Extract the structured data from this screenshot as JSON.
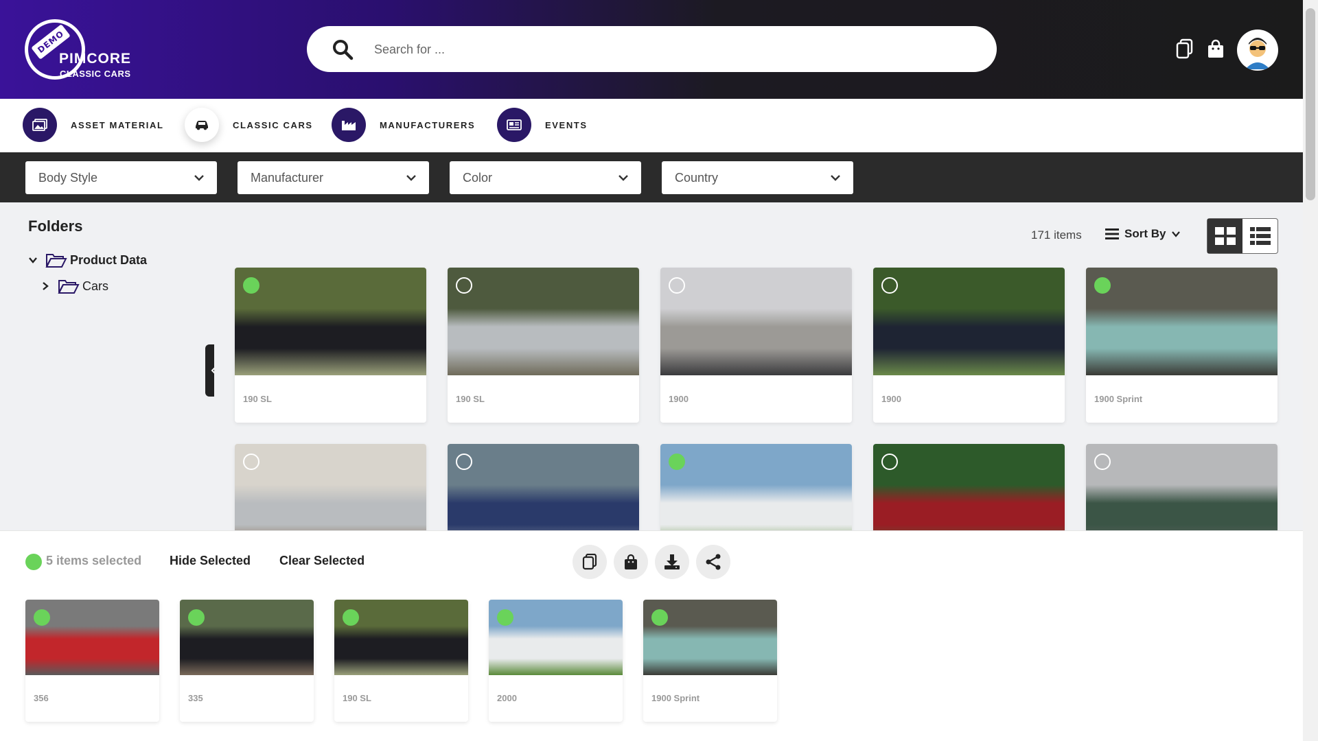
{
  "header": {
    "logo_demo": "DEMO",
    "logo_name": "PIMCORE",
    "logo_sub": "CLASSIC CARS",
    "search_placeholder": "Search for ...",
    "icons": [
      "search-icon",
      "copy-icon",
      "bag-icon",
      "avatar"
    ]
  },
  "nav": {
    "items": [
      {
        "label": "ASSET MATERIAL",
        "icon": "images-icon",
        "active": false
      },
      {
        "label": "CLASSIC CARS",
        "icon": "car-icon",
        "active": true
      },
      {
        "label": "MANUFACTURERS",
        "icon": "factory-icon",
        "active": false
      },
      {
        "label": "EVENTS",
        "icon": "newspaper-icon",
        "active": false
      }
    ]
  },
  "filters": [
    "Body Style",
    "Manufacturer",
    "Color",
    "Country"
  ],
  "sidebar": {
    "title": "Folders",
    "tree": [
      {
        "label": "Product Data",
        "expanded": true
      },
      {
        "label": "Cars",
        "expanded": false
      }
    ]
  },
  "toolbar": {
    "count": "171 items",
    "sort_label": "Sort By",
    "view_mode": "grid"
  },
  "cards": [
    {
      "title": "190 SL",
      "selected": true,
      "colors": [
        "#5a6b3a",
        "#1d1d22",
        "#9aa07a"
      ]
    },
    {
      "title": "190 SL",
      "selected": false,
      "colors": [
        "#4e5a3e",
        "#b8bcbf",
        "#6f6b5a"
      ]
    },
    {
      "title": "1900",
      "selected": false,
      "colors": [
        "#cfcfd2",
        "#9c9a96",
        "#3a3a3d"
      ]
    },
    {
      "title": "1900",
      "selected": false,
      "colors": [
        "#3b5a2a",
        "#1e2433",
        "#6b8a4a"
      ]
    },
    {
      "title": "1900 Sprint",
      "selected": true,
      "colors": [
        "#5a5a50",
        "#86b7b2",
        "#3a3a35"
      ]
    },
    {
      "title": "",
      "selected": false,
      "colors": [
        "#d8d4cc",
        "#b9bcbf",
        "#7a5a3a"
      ]
    },
    {
      "title": "",
      "selected": false,
      "colors": [
        "#6a7e8a",
        "#2a3a6a",
        "#9aa0a8"
      ]
    },
    {
      "title": "",
      "selected": true,
      "colors": [
        "#7ea7c9",
        "#e9ebec",
        "#5a8a3a"
      ]
    },
    {
      "title": "",
      "selected": false,
      "colors": [
        "#2d5a2a",
        "#9a1d24",
        "#4a6a3a"
      ]
    },
    {
      "title": "",
      "selected": false,
      "colors": [
        "#b7b8ba",
        "#3b5546",
        "#6a6a6a"
      ]
    }
  ],
  "selection": {
    "count_text": "5 items selected",
    "hide_label": "Hide Selected",
    "clear_label": "Clear Selected",
    "actions": [
      "copy-icon",
      "bag-icon",
      "download-icon",
      "share-icon"
    ],
    "items": [
      {
        "title": "356",
        "colors": [
          "#7a7a7a",
          "#c2262b",
          "#5a5a5a"
        ]
      },
      {
        "title": "335",
        "colors": [
          "#5a6a4a",
          "#1d1d22",
          "#7a6a5a"
        ]
      },
      {
        "title": "190 SL",
        "colors": [
          "#5a6b3a",
          "#1d1d22",
          "#9aa07a"
        ]
      },
      {
        "title": "2000",
        "colors": [
          "#7ea7c9",
          "#e9ebec",
          "#5a8a3a"
        ]
      },
      {
        "title": "1900 Sprint",
        "colors": [
          "#5a5a50",
          "#86b7b2",
          "#3a3a35"
        ]
      }
    ]
  },
  "colors": {
    "brand_purple": "#3a1299",
    "nav_circle": "#2a1866",
    "filter_bar": "#2b2b2b",
    "selected_green": "#6ad35a"
  }
}
